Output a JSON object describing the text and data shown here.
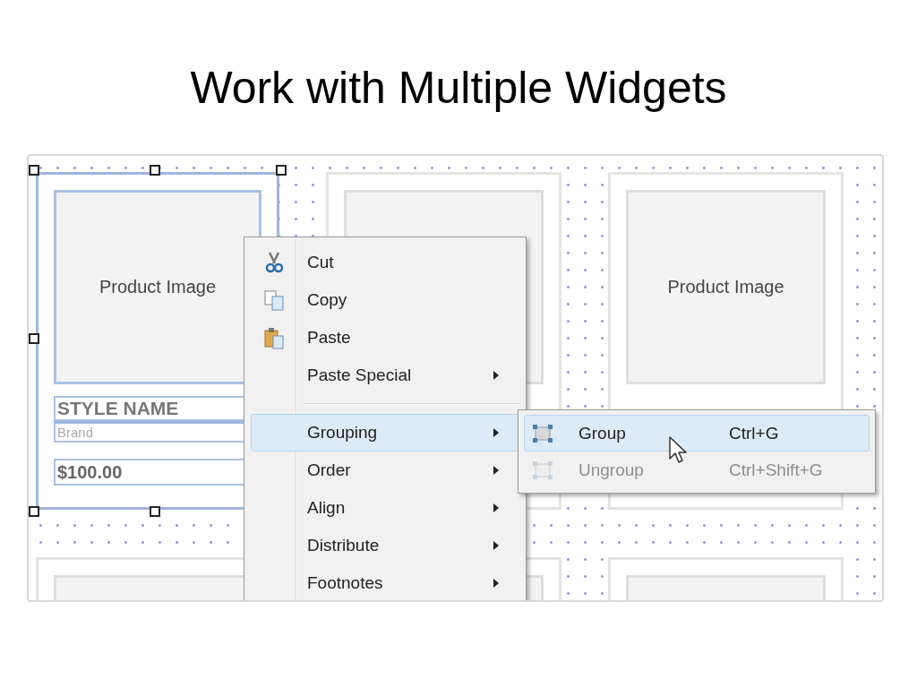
{
  "slide": {
    "title": "Work with Multiple Widgets"
  },
  "canvas": {
    "cards": [
      {
        "selected": true,
        "image_label": "Product Image",
        "style_name": "STYLE NAME",
        "brand": "Brand",
        "price": "$100.00"
      },
      {
        "selected": false
      },
      {
        "selected": false,
        "image_label": "Product Image"
      },
      {
        "selected": false
      },
      {
        "selected": false
      },
      {
        "selected": false
      }
    ]
  },
  "context_menu": {
    "items": [
      {
        "kind": "command",
        "label": "Cut",
        "has_submenu": false,
        "selected": false
      },
      {
        "kind": "command",
        "label": "Copy",
        "has_submenu": false,
        "selected": false
      },
      {
        "kind": "command",
        "label": "Paste",
        "has_submenu": false,
        "selected": false
      },
      {
        "kind": "command",
        "label": "Paste Special",
        "has_submenu": true,
        "selected": false
      },
      {
        "kind": "separator"
      },
      {
        "kind": "command",
        "label": "Grouping",
        "has_submenu": true,
        "selected": true
      },
      {
        "kind": "command",
        "label": "Order",
        "has_submenu": true,
        "selected": false
      },
      {
        "kind": "command",
        "label": "Align",
        "has_submenu": true,
        "selected": false
      },
      {
        "kind": "command",
        "label": "Distribute",
        "has_submenu": true,
        "selected": false
      },
      {
        "kind": "command",
        "label": "Footnotes",
        "has_submenu": true,
        "selected": false
      }
    ]
  },
  "submenu": {
    "items": [
      {
        "label": "Group",
        "shortcut": "Ctrl+G",
        "selected": true,
        "disabled": false
      },
      {
        "label": "Ungroup",
        "shortcut": "Ctrl+Shift+G",
        "selected": false,
        "disabled": true
      }
    ]
  }
}
